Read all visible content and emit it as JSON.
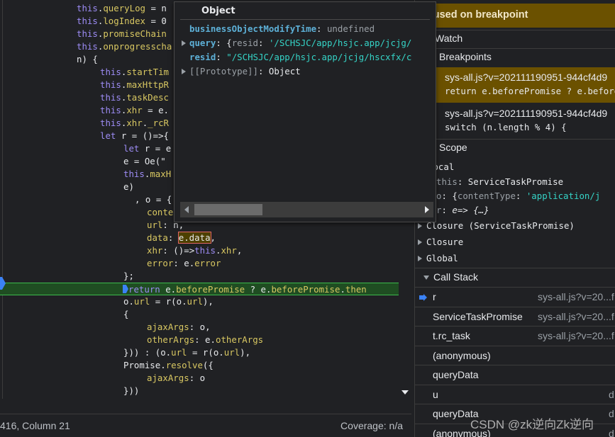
{
  "editor": {
    "lines": [
      {
        "indent": 108,
        "tokens": [
          [
            "this",
            "k"
          ],
          [
            ".",
            "t"
          ],
          [
            "queryLog",
            "p"
          ],
          [
            " = n",
            "t"
          ]
        ]
      },
      {
        "indent": 108,
        "tokens": [
          [
            "this",
            "k"
          ],
          [
            ".",
            "t"
          ],
          [
            "logIndex",
            "p"
          ],
          [
            " = 0",
            "t"
          ]
        ]
      },
      {
        "indent": 108,
        "tokens": [
          [
            "this",
            "k"
          ],
          [
            ".",
            "t"
          ],
          [
            "promiseChain",
            "p"
          ]
        ]
      },
      {
        "indent": 108,
        "tokens": [
          [
            "this",
            "k"
          ],
          [
            ".",
            "t"
          ],
          [
            "onprogresscha",
            "p"
          ]
        ]
      },
      {
        "indent": 108,
        "tokens": [
          [
            "n) {",
            "t"
          ]
        ]
      },
      {
        "indent": 141,
        "tokens": [
          [
            "this",
            "k"
          ],
          [
            ".",
            "t"
          ],
          [
            "startTim",
            "p"
          ]
        ]
      },
      {
        "indent": 141,
        "tokens": [
          [
            "this",
            "k"
          ],
          [
            ".",
            "t"
          ],
          [
            "maxHttpR",
            "p"
          ]
        ]
      },
      {
        "indent": 141,
        "tokens": [
          [
            "this",
            "k"
          ],
          [
            ".",
            "t"
          ],
          [
            "taskDesc",
            "p"
          ]
        ]
      },
      {
        "indent": 141,
        "tokens": [
          [
            "this",
            "k"
          ],
          [
            ".",
            "t"
          ],
          [
            "xhr",
            "p"
          ],
          [
            " = e.",
            "t"
          ]
        ]
      },
      {
        "indent": 141,
        "tokens": [
          [
            "this",
            "k"
          ],
          [
            ".",
            "t"
          ],
          [
            "xhr",
            "p"
          ],
          [
            ".",
            "t"
          ],
          [
            "_rcR",
            "p"
          ]
        ]
      },
      {
        "indent": 141,
        "tokens": [
          [
            "let",
            "k"
          ],
          [
            " r = ()=>{",
            "t"
          ]
        ]
      },
      {
        "indent": 174,
        "tokens": [
          [
            "let",
            "k"
          ],
          [
            " r = e",
            "t"
          ]
        ]
      },
      {
        "indent": 174,
        "tokens": [
          [
            "e = Oe(\"",
            "t"
          ]
        ]
      },
      {
        "indent": 174,
        "tokens": [
          [
            "this",
            "k"
          ],
          [
            ".",
            "t"
          ],
          [
            "maxH",
            "p"
          ]
        ]
      },
      {
        "indent": 174,
        "tokens": [
          [
            "e)",
            "t"
          ]
        ]
      },
      {
        "indent": 190,
        "tokens": [
          [
            ", o = {",
            "t"
          ]
        ]
      },
      {
        "indent": 207,
        "tokens": [
          [
            "conte",
            "p"
          ]
        ]
      },
      {
        "indent": 207,
        "tokens": [
          [
            "url",
            "p"
          ],
          [
            ": n,",
            "t"
          ]
        ]
      },
      {
        "indent": 207,
        "tokens": [
          [
            "data",
            "p"
          ],
          [
            ": ",
            "t"
          ],
          [
            "e.data",
            "boxed"
          ],
          [
            ",",
            "t"
          ]
        ]
      },
      {
        "indent": 207,
        "tokens": [
          [
            "xhr",
            "p"
          ],
          [
            ": ()=>",
            "t"
          ],
          [
            "this",
            "k"
          ],
          [
            ".",
            "t"
          ],
          [
            "xhr",
            "p"
          ],
          [
            ",",
            "t"
          ]
        ]
      },
      {
        "indent": 207,
        "tokens": [
          [
            "error",
            "p"
          ],
          [
            ": e.",
            "t"
          ],
          [
            "error",
            "p"
          ]
        ]
      },
      {
        "indent": 174,
        "tokens": [
          [
            "};",
            "t"
          ]
        ]
      },
      {
        "indent": 174,
        "highlight": true,
        "tokens": [
          [
            "return",
            "k"
          ],
          [
            " e.",
            "t"
          ],
          [
            "beforePromise",
            "p"
          ],
          [
            " ? e.",
            "t"
          ],
          [
            "beforePromise",
            "p"
          ],
          [
            ".",
            "t"
          ],
          [
            "then",
            "p"
          ]
        ]
      },
      {
        "indent": 174,
        "tokens": [
          [
            "o.",
            "t"
          ],
          [
            "url",
            "p"
          ],
          [
            " = r(o.",
            "t"
          ],
          [
            "url",
            "p"
          ],
          [
            "),",
            "t"
          ]
        ]
      },
      {
        "indent": 174,
        "tokens": [
          [
            "{",
            "t"
          ]
        ]
      },
      {
        "indent": 207,
        "tokens": [
          [
            "ajaxArgs",
            "p"
          ],
          [
            ": o,",
            "t"
          ]
        ]
      },
      {
        "indent": 207,
        "tokens": [
          [
            "otherArgs",
            "p"
          ],
          [
            ": e.",
            "t"
          ],
          [
            "otherArgs",
            "p"
          ]
        ]
      },
      {
        "indent": 174,
        "tokens": [
          [
            "})) : (o.",
            "t"
          ],
          [
            "url",
            "p"
          ],
          [
            " = r(o.",
            "t"
          ],
          [
            "url",
            "p"
          ],
          [
            "),",
            "t"
          ]
        ]
      },
      {
        "indent": 174,
        "tokens": [
          [
            "Promise.",
            "t"
          ],
          [
            "resolve",
            "p"
          ],
          [
            "({",
            "t"
          ]
        ]
      },
      {
        "indent": 207,
        "tokens": [
          [
            "ajaxArgs",
            "p"
          ],
          [
            ": o",
            "t"
          ]
        ]
      },
      {
        "indent": 174,
        "tokens": [
          [
            "}))",
            "t"
          ]
        ]
      }
    ]
  },
  "status": {
    "position": "416, Column 21",
    "coverage": "Coverage: n/a"
  },
  "popup": {
    "title": "Object",
    "r1_key": "businessObjectModifyTime",
    "r1_val": "undefined",
    "r2_key": "query",
    "r2_pre": "{",
    "r2_sub": "resid",
    "r2_val": "'/SCHSJC/app/hsjc.app/jcjg/",
    "r3_key": "resid",
    "r3_val": "\"/SCHSJC/app/hsjc.app/jcjg/hscxfx/c",
    "r4_key": "[[Prototype]]",
    "r4_val": "Object"
  },
  "sidebar": {
    "paused": "Paused on breakpoint",
    "watch": "Watch",
    "breakpoints": "Breakpoints",
    "bp1_file": "sys-all.js?v=202111190951-944cf4d9",
    "bp1_code": "return e.beforePromise ? e.beforePromise",
    "bp2_file": "sys-all.js?v=202111190951-944cf4d9",
    "bp2_code": "switch (n.length % 4) {",
    "scope": "Scope",
    "local": "Local",
    "this_key": "this",
    "this_val": "ServiceTaskPromise",
    "o_key": "o",
    "o_pre": "{",
    "o_sub": "contentType",
    "o_val": "'application/j",
    "r_key": "r",
    "r_val": "e=> {…}",
    "closure1": "Closure (ServiceTaskPromise)",
    "closure2": "Closure",
    "global": "Global",
    "callstack": "Call Stack",
    "frames": [
      {
        "name": "r",
        "loc": "sys-all.js?v=20...f",
        "current": true
      },
      {
        "name": "ServiceTaskPromise",
        "loc": "sys-all.js?v=20...f"
      },
      {
        "name": "t.rc_task",
        "loc": "sys-all.js?v=20...f"
      },
      {
        "name": "(anonymous)",
        "loc": ""
      },
      {
        "name": "queryData",
        "loc": ""
      },
      {
        "name": "u",
        "loc": "d"
      },
      {
        "name": "queryData",
        "loc": "d"
      },
      {
        "name": "(anonymous)",
        "loc": "d"
      }
    ]
  },
  "watermark": "CSDN @zk逆向Zk逆向"
}
